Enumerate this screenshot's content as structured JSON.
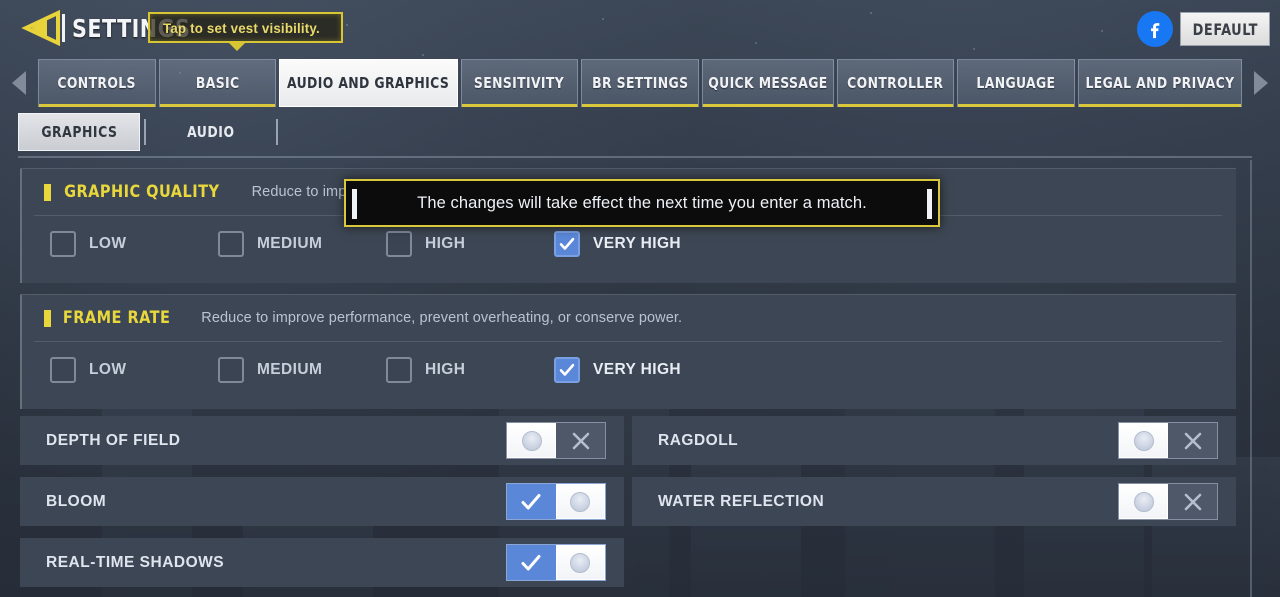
{
  "header": {
    "back_icon": "back-arrow-icon",
    "title": "SETTINGS",
    "hint": "Tap to set vest visibility.",
    "facebook_icon": "facebook-icon",
    "default_label": "DEFAULT"
  },
  "tabbar": {
    "scroll_left_icon": "chevron-left-icon",
    "scroll_right_icon": "chevron-right-icon",
    "tabs": [
      {
        "label": "CONTROLS",
        "active": false
      },
      {
        "label": "BASIC",
        "active": false
      },
      {
        "label": "AUDIO AND GRAPHICS",
        "active": true
      },
      {
        "label": "SENSITIVITY",
        "active": false
      },
      {
        "label": "BR SETTINGS",
        "active": false
      },
      {
        "label": "QUICK MESSAGE",
        "active": false
      },
      {
        "label": "CONTROLLER",
        "active": false
      },
      {
        "label": "LANGUAGE",
        "active": false
      },
      {
        "label": "LEGAL AND PRIVACY",
        "active": false
      }
    ]
  },
  "subtabs": [
    {
      "label": "GRAPHICS",
      "active": true
    },
    {
      "label": "AUDIO",
      "active": false
    }
  ],
  "tooltip": {
    "text": "The changes will take effect the next time you enter a match.",
    "border_color": "#d9c83b",
    "background": "#0c0c0c"
  },
  "sections": [
    {
      "title": "GRAPHIC QUALITY",
      "description": "Reduce to improve performance, prevent overheating, or conserve power.",
      "options": [
        {
          "label": "LOW",
          "checked": false
        },
        {
          "label": "MEDIUM",
          "checked": false
        },
        {
          "label": "HIGH",
          "checked": false
        },
        {
          "label": "VERY HIGH",
          "checked": true
        }
      ]
    },
    {
      "title": "FRAME RATE",
      "description": "Reduce to improve performance, prevent overheating, or conserve power.",
      "options": [
        {
          "label": "LOW",
          "checked": false
        },
        {
          "label": "MEDIUM",
          "checked": false
        },
        {
          "label": "HIGH",
          "checked": false
        },
        {
          "label": "VERY HIGH",
          "checked": true
        }
      ]
    }
  ],
  "toggles": {
    "left": [
      {
        "label": "DEPTH OF FIELD",
        "on": false
      },
      {
        "label": "BLOOM",
        "on": true
      },
      {
        "label": "REAL-TIME SHADOWS",
        "on": true
      }
    ],
    "right": [
      {
        "label": "RAGDOLL",
        "on": false
      },
      {
        "label": "WATER REFLECTION",
        "on": false
      }
    ]
  },
  "colors": {
    "accent_yellow": "#e9d83c",
    "accent_blue": "#5b87d8",
    "panel": "#3d4654",
    "facebook_blue": "#1877f2"
  }
}
